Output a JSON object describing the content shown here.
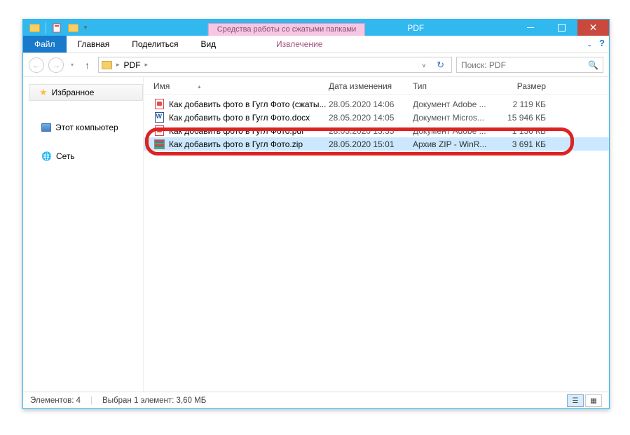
{
  "window": {
    "title": "PDF",
    "context_tab": "Средства работы со сжатыми папками"
  },
  "ribbon": {
    "file": "Файл",
    "home": "Главная",
    "share": "Поделиться",
    "view": "Вид",
    "extract": "Извлечение"
  },
  "address": {
    "folder": "PDF",
    "search_placeholder": "Поиск: PDF"
  },
  "sidebar": {
    "favorites": "Избранное",
    "this_pc": "Этот компьютер",
    "network": "Сеть"
  },
  "columns": {
    "name": "Имя",
    "date": "Дата изменения",
    "type": "Тип",
    "size": "Размер"
  },
  "files": [
    {
      "name": "Как добавить фото в Гугл Фото (сжаты...",
      "date": "28.05.2020 14:06",
      "type": "Документ Adobe ...",
      "size": "2 119 КБ",
      "icon": "pdf"
    },
    {
      "name": "Как добавить фото в Гугл Фото.docx",
      "date": "28.05.2020 14:05",
      "type": "Документ Micros...",
      "size": "15 946 КБ",
      "icon": "docx"
    },
    {
      "name": "Как добавить фото в Гугл Фото.pdf",
      "date": "28.05.2020 13:35",
      "type": "Документ Adobe ...",
      "size": "1 136 КБ",
      "icon": "pdf"
    },
    {
      "name": "Как добавить фото в Гугл Фото.zip",
      "date": "28.05.2020 15:01",
      "type": "Архив ZIP - WinR...",
      "size": "3 691 КБ",
      "icon": "zip"
    }
  ],
  "status": {
    "count": "Элементов: 4",
    "selection": "Выбран 1 элемент: 3,60 МБ"
  }
}
